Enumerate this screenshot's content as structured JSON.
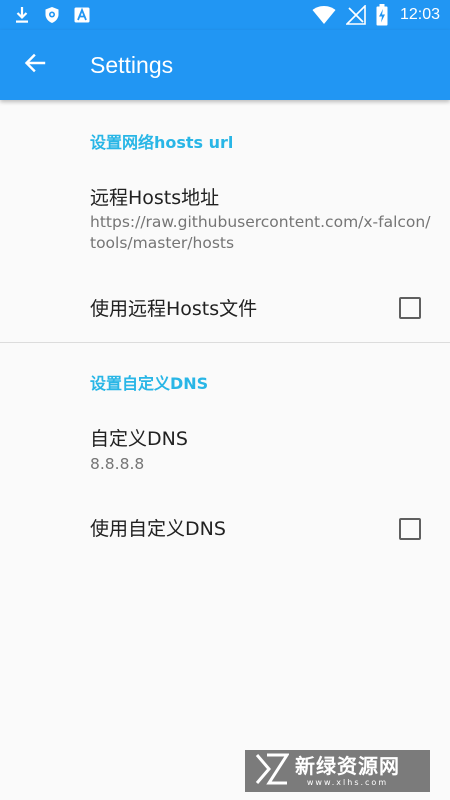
{
  "status_bar": {
    "time": "12:03",
    "left_icons": [
      "download-icon",
      "shield-icon",
      "a-icon"
    ],
    "right_icons": [
      "wifi-icon",
      "no-signal-icon",
      "battery-charging-icon"
    ],
    "color": "#2196f3"
  },
  "app_bar": {
    "title": "Settings",
    "back_icon": "arrow-back-icon",
    "color": "#2196f3"
  },
  "sections": [
    {
      "category": "设置网络hosts url",
      "items": [
        {
          "title": "远程Hosts地址",
          "summary": "https://raw.githubusercontent.com/x-falcon/tools/master/hosts"
        },
        {
          "title": "使用远程Hosts文件",
          "checked": false
        }
      ]
    },
    {
      "category": "设置自定义DNS",
      "items": [
        {
          "title": "自定义DNS",
          "summary": "8.8.8.8"
        },
        {
          "title": "使用自定义DNS",
          "checked": false
        }
      ]
    }
  ],
  "watermark": {
    "text": "新绿资源网",
    "subtext": "www.xlhs.com"
  },
  "colors": {
    "accent": "#29b6e6",
    "primary": "#2196f3",
    "background": "#fafafa"
  }
}
